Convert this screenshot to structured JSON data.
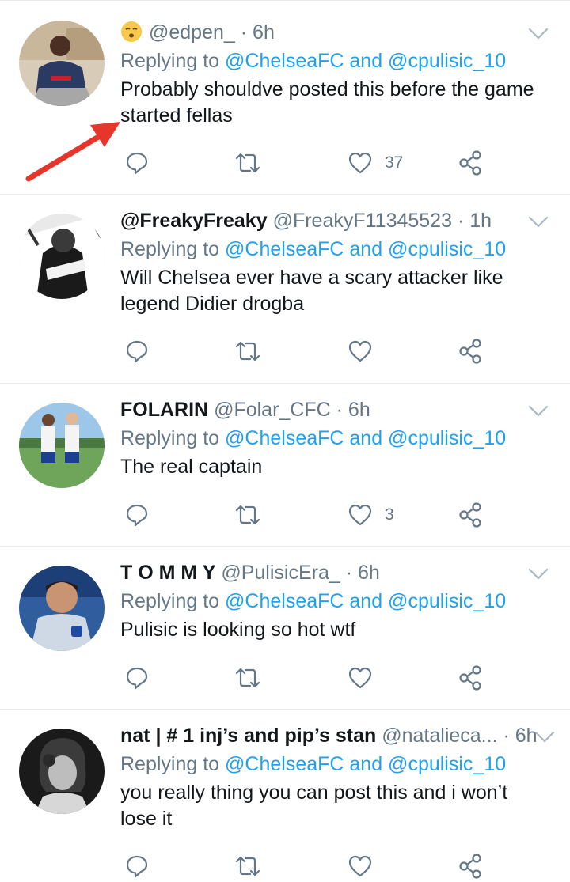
{
  "colors": {
    "accent": "#1da1f2",
    "secondary_text": "#657786",
    "primary_text": "#14171a",
    "divider": "#e6ecf0",
    "annotation_arrow": "#e8352b"
  },
  "reply_prefix": "Replying to",
  "reply_targets": "@ChelseaFC and @cpulisic_10",
  "tweets": [
    {
      "display_name": "",
      "emoji": "face-exhaling-emoji",
      "handle": "@edpen_",
      "time": "· 6h",
      "text": "Probably shouldve posted this before the game started fellas",
      "likes": "37"
    },
    {
      "display_name": "@FreakyFreaky",
      "handle": "@FreakyF11345523",
      "time": "· 1h",
      "text": "Will Chelsea ever have a scary attacker like legend Didier drogba",
      "likes": ""
    },
    {
      "display_name": "FOLARIN",
      "handle": "@Folar_CFC",
      "time": "· 6h",
      "text": "The real captain",
      "likes": "3"
    },
    {
      "display_name": "T O M M Y",
      "handle": "@PulisicEra_",
      "time": "· 6h",
      "text": "Pulisic is looking so hot wtf",
      "likes": ""
    },
    {
      "display_name": "nat | # 1 inj’s and pip’s stan",
      "handle": "@natalieca...",
      "time": "· 6h",
      "text": "you really thing you can post this and i won’t lose it",
      "likes": ""
    }
  ],
  "icons": {
    "reply": "reply-icon",
    "retweet": "retweet-icon",
    "like": "like-icon",
    "share": "share-icon",
    "more": "chevron-down-icon"
  }
}
